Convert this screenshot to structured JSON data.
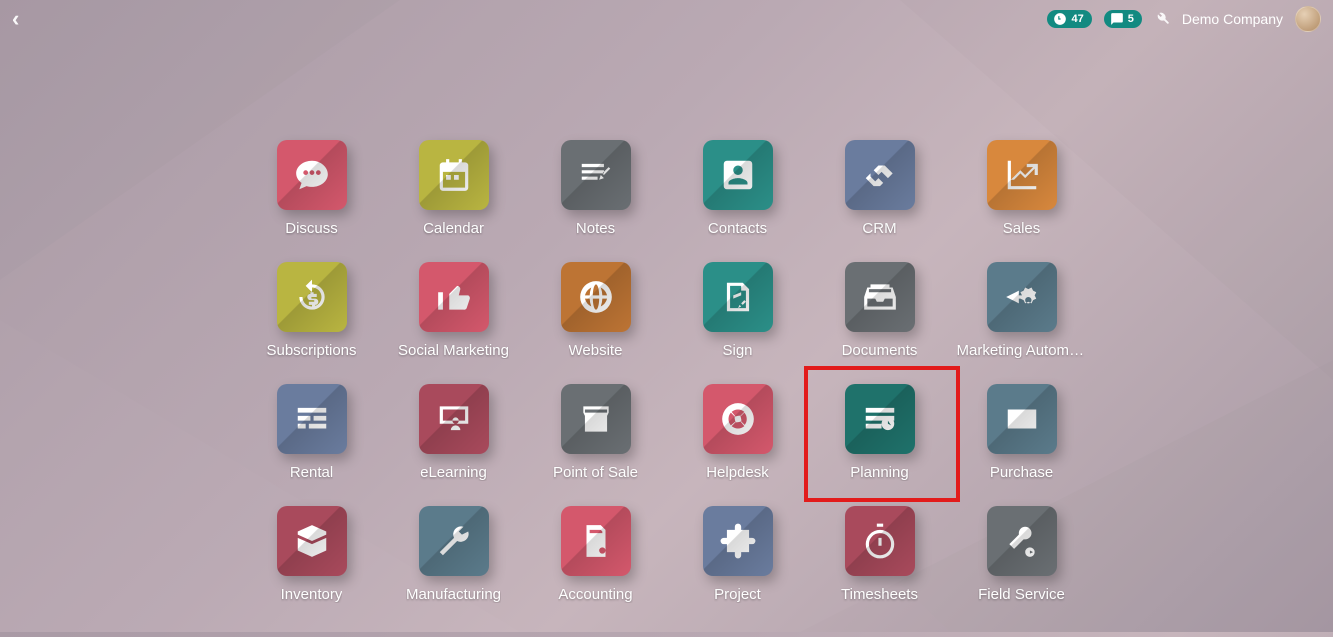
{
  "navbar": {
    "activities_count": "47",
    "messages_count": "5",
    "company": "Demo Company"
  },
  "apps": [
    {
      "label": "Discuss",
      "color": "c-pink",
      "icon": "chat-icon"
    },
    {
      "label": "Calendar",
      "color": "c-olive",
      "icon": "calendar-icon"
    },
    {
      "label": "Notes",
      "color": "c-gray",
      "icon": "notes-icon"
    },
    {
      "label": "Contacts",
      "color": "c-teal",
      "icon": "contacts-icon"
    },
    {
      "label": "CRM",
      "color": "c-indigo",
      "icon": "handshake-icon"
    },
    {
      "label": "Sales",
      "color": "c-orange",
      "icon": "chart-up-icon"
    },
    {
      "label": "Subscriptions",
      "color": "c-olive",
      "icon": "refresh-dollar-icon"
    },
    {
      "label": "Social Marketing",
      "color": "c-pink",
      "icon": "thumbsup-icon"
    },
    {
      "label": "Website",
      "color": "c-darkorange",
      "icon": "globe-icon"
    },
    {
      "label": "Sign",
      "color": "c-teal",
      "icon": "sign-icon"
    },
    {
      "label": "Documents",
      "color": "c-gray",
      "icon": "drawer-icon"
    },
    {
      "label": "Marketing Automation",
      "color": "c-steel",
      "icon": "gear-send-icon"
    },
    {
      "label": "Rental",
      "color": "c-indigo",
      "icon": "grid-cal-icon"
    },
    {
      "label": "eLearning",
      "color": "c-darkpink",
      "icon": "board-icon"
    },
    {
      "label": "Point of Sale",
      "color": "c-gray",
      "icon": "store-icon"
    },
    {
      "label": "Helpdesk",
      "color": "c-pink",
      "icon": "lifering-icon"
    },
    {
      "label": "Planning",
      "color": "c-darkteal",
      "icon": "schedule-icon",
      "highlight": true
    },
    {
      "label": "Purchase",
      "color": "c-steel",
      "icon": "card-icon"
    },
    {
      "label": "Inventory",
      "color": "c-darkpink",
      "icon": "box-icon"
    },
    {
      "label": "Manufacturing",
      "color": "c-steel",
      "icon": "wrench-icon"
    },
    {
      "label": "Accounting",
      "color": "c-pink",
      "icon": "invoice-icon"
    },
    {
      "label": "Project",
      "color": "c-indigo",
      "icon": "puzzle-icon"
    },
    {
      "label": "Timesheets",
      "color": "c-darkpink",
      "icon": "stopwatch-icon"
    },
    {
      "label": "Field Service",
      "color": "c-gray",
      "icon": "service-icon"
    }
  ]
}
